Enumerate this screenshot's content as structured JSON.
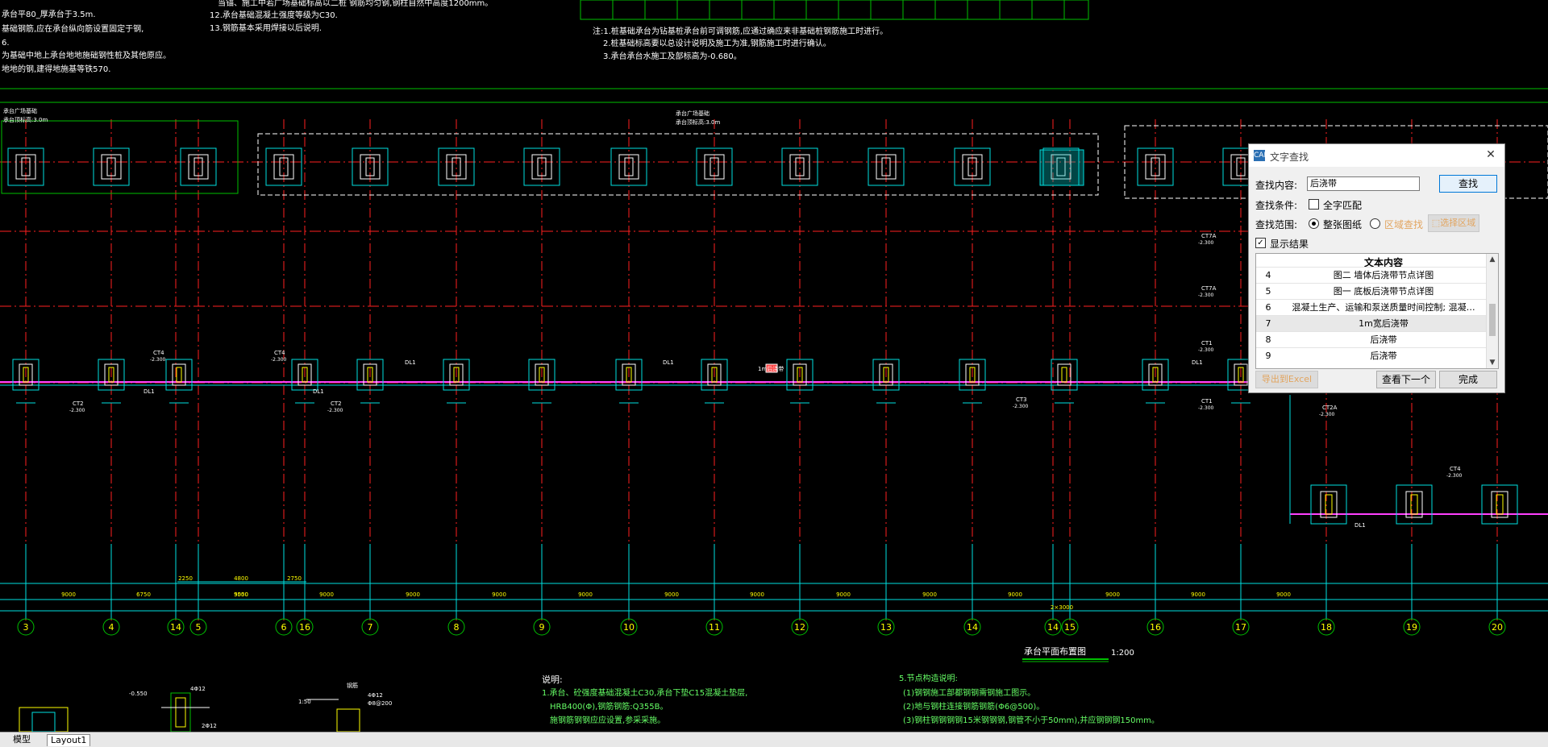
{
  "drawing": {
    "top_notes_left": [
      "承台平80_厚承台于3.5m.",
      "基础钢筋,应在承台纵向筋设置固定于钢,",
      "6.",
      "为基础中地上承台地地施础钢性桩及其他原应。",
      "地地的钢,建得地施基等铁570."
    ],
    "top_notes_mid": [
      "12.承台基础混凝土强度等级为C30.",
      "13.钢筋基本采用焊接以后说明."
    ],
    "top_notes_mid_head": "当锚、施工中若广场基础标高以二桩 钢筋均匀钢,钢柱自然中高度1200mm。",
    "top_notes_right": [
      "注:1.桩基础承台为钻基桩承台前可调钢筋,应通过确应来非基础桩钢筋施工时进行。",
      "2.桩基础标高要以总设计说明及施工为准,钢筋施工时进行确认。",
      "3.承台承台水施工及部标高为-0.680。"
    ],
    "small_label_1": "承台广场基础",
    "small_label_1b": "承台顶标高:3.0m",
    "small_label_2": "承台广场基础",
    "small_label_2b": "承台顶标高:3.0m",
    "axes": [
      "3",
      "4",
      "14",
      "5",
      "6",
      "16",
      "7",
      "8",
      "9",
      "10",
      "11",
      "12",
      "13",
      "14",
      "14",
      "15",
      "16",
      "17",
      "18",
      "19",
      "20"
    ],
    "dim_values": [
      "9000",
      "6750",
      "9000",
      "9000",
      "9000",
      "9000",
      "9000",
      "9000",
      "9000",
      "9000",
      "9000",
      "9000",
      "9000",
      "9000",
      "9000"
    ],
    "dim_upper": [
      "2250",
      "4800",
      "2750"
    ],
    "dim_upper2": "5550",
    "dim_total": "2×3000",
    "labels_ct": [
      "CT4",
      "CT4",
      "CT2",
      "CT2",
      "CT3",
      "CT1",
      "CT7A",
      "CT7A",
      "CT1",
      "CT2A",
      "CT4"
    ],
    "labels_dl": [
      "DL1",
      "DL1",
      "DL1",
      "DL1",
      "DL1",
      "DL1"
    ],
    "elev": "-2.300",
    "plan_title": "承台平面布置图",
    "plan_scale": "1:200",
    "bottom_notes_head": "说明:",
    "bottom_notes": [
      "1.承台、砼强度基础混凝土C30,承台下垫C15混凝土垫层,",
      "HRB400(Φ),钢筋钢筋:Q355B。",
      "施钢筋钢钢应应设置,参采采施。"
    ],
    "bottom_notes_right": [
      "5.节点构造说明:",
      "(1)钢钢施工部都钢钢需钢施工图示。",
      "(2)地与钢柱连接钢筋钢筋(Φ6@500)。",
      "(3)钢柱钢钢钢钢15米钢钢钢,钢管不小于50mm),并应钢钢钢150mm。"
    ],
    "section_labels": [
      "-0.550",
      "4Φ12",
      "2Φ12",
      "1:50",
      "钢筋",
      "4Φ12",
      "Φ8@200"
    ],
    "tag": "1m后浇带"
  },
  "tabs": [
    "模型",
    "Layout1"
  ],
  "dialog": {
    "title": "文字查找",
    "logo": "CAD",
    "find_label": "查找内容:",
    "find_value": "后浇带",
    "find_button": "查找",
    "condition_label": "查找条件:",
    "whole_word": "全字匹配",
    "whole_word_checked": false,
    "range_label": "查找范围:",
    "range_all": "整张图纸",
    "range_area": "区域查找",
    "select_area": "选择区域",
    "show_results": "显示结果",
    "show_results_checked": true,
    "list_header": "文本内容",
    "rows": [
      {
        "idx": "4",
        "text": "图二 墙体后浇带节点详图"
      },
      {
        "idx": "5",
        "text": "图一 底板后浇带节点详图"
      },
      {
        "idx": "6",
        "text": "混凝土生产、运输和泵送质量时间控制; 混凝…"
      },
      {
        "idx": "7",
        "text": "1m宽后浇带"
      },
      {
        "idx": "8",
        "text": "后浇带"
      },
      {
        "idx": "9",
        "text": "后浇带"
      }
    ],
    "selected_row": 3,
    "export_button": "导出到Excel",
    "next_button": "查看下一个",
    "done_button": "完成"
  },
  "colors": {
    "background": "#000000",
    "red_axis": "#ff2020",
    "cyan": "#00e0e0",
    "green": "#00c000",
    "yellow": "#ffff00",
    "magenta": "#ff40ff",
    "white": "#ffffff",
    "accent_orange": "#e2a560"
  }
}
